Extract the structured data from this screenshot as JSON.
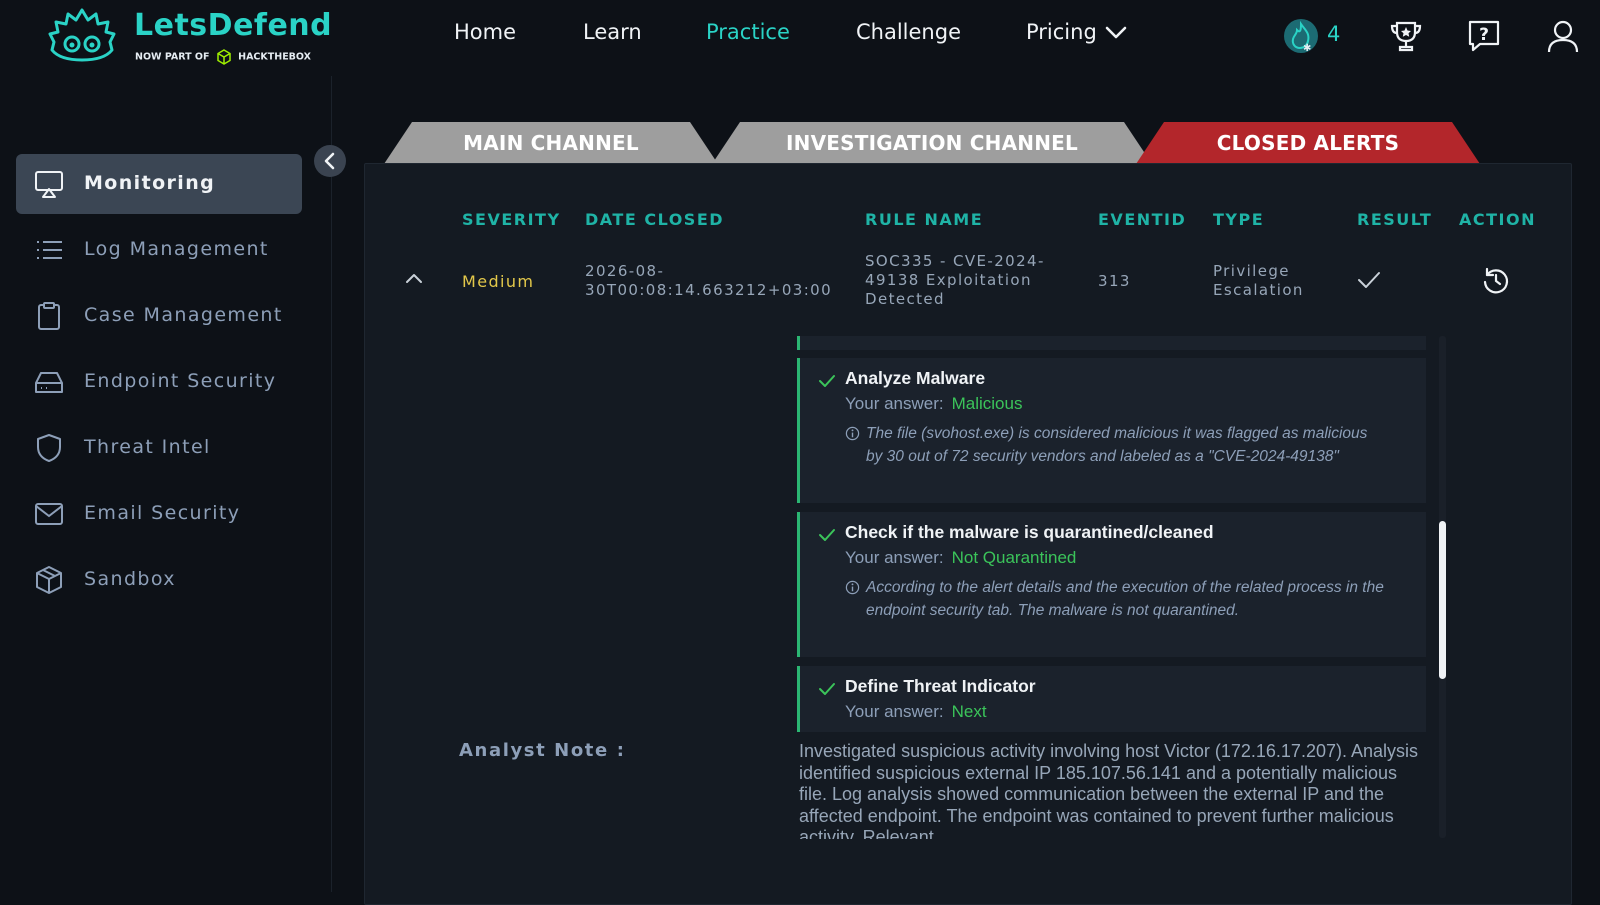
{
  "brand": {
    "title": "LetsDefend",
    "subtitle_prefix": "NOW PART OF",
    "subtitle_brand": "HACKTHEBOX"
  },
  "nav": {
    "links": [
      {
        "label": "Home",
        "active": false
      },
      {
        "label": "Learn",
        "active": false
      },
      {
        "label": "Practice",
        "active": true
      },
      {
        "label": "Challenge",
        "active": false
      },
      {
        "label": "Pricing",
        "active": false
      }
    ],
    "streak_count": "4",
    "icons": [
      "streak-flame-icon",
      "trophy-icon",
      "help-icon",
      "user-icon"
    ]
  },
  "sidebar": {
    "items": [
      {
        "label": "Monitoring",
        "icon": "monitor-icon",
        "active": true
      },
      {
        "label": "Log Management",
        "icon": "list-icon"
      },
      {
        "label": "Case Management",
        "icon": "clipboard-icon"
      },
      {
        "label": "Endpoint Security",
        "icon": "drive-icon"
      },
      {
        "label": "Threat Intel",
        "icon": "shield-icon"
      },
      {
        "label": "Email Security",
        "icon": "mail-icon"
      },
      {
        "label": "Sandbox",
        "icon": "cube-icon"
      }
    ]
  },
  "tabs": [
    {
      "label": "MAIN CHANNEL",
      "color": "#9e9e9e"
    },
    {
      "label": "INVESTIGATION CHANNEL",
      "color": "#9e9e9e"
    },
    {
      "label": "CLOSED ALERTS",
      "color": "#b3262b"
    }
  ],
  "table": {
    "headers": [
      "SEVERITY",
      "DATE CLOSED",
      "RULE NAME",
      "EVENTID",
      "TYPE",
      "RESULT",
      "ACTION"
    ],
    "row": {
      "severity": "Medium",
      "date_closed_line1": "2026-08-",
      "date_closed_line2": "30T00:08:14.663212+03:00",
      "rule_line1": "SOC335 - CVE-2024-",
      "rule_line2": "49138 Exploitation",
      "rule_line3": "Detected",
      "eventid": "313",
      "type_line1": "Privilege",
      "type_line2": "Escalation"
    }
  },
  "tasks": [
    {
      "title": "Analyze Malware",
      "answer_label": "Your answer:",
      "answer": "Malicious",
      "note": "The file (svohost.exe) is considered malicious it was flagged as malicious by 30 out of 72 security vendors and labeled as a \"CVE-2024-49138\""
    },
    {
      "title": "Check if the malware is quarantined/cleaned",
      "answer_label": "Your answer:",
      "answer": "Not Quarantined",
      "note": "According to the alert details and the execution of the related process in the endpoint security tab. The malware is not quarantined."
    },
    {
      "title": "Define Threat Indicator",
      "answer_label": "Your answer:",
      "answer": "Next"
    }
  ],
  "analyst_note": {
    "label": "Analyst Note :",
    "text": "Investigated suspicious activity involving host Victor (172.16.17.207). Analysis identified suspicious external IP 185.107.56.141 and a potentially malicious file. Log analysis showed communication between the external IP and the affected endpoint. The endpoint was contained to prevent further malicious activity. Relevant"
  },
  "colors": {
    "accent": "#2ad3c6",
    "severity_medium": "#e3c84a",
    "answer_green": "#3bc45a",
    "tab_active": "#b3262b"
  }
}
